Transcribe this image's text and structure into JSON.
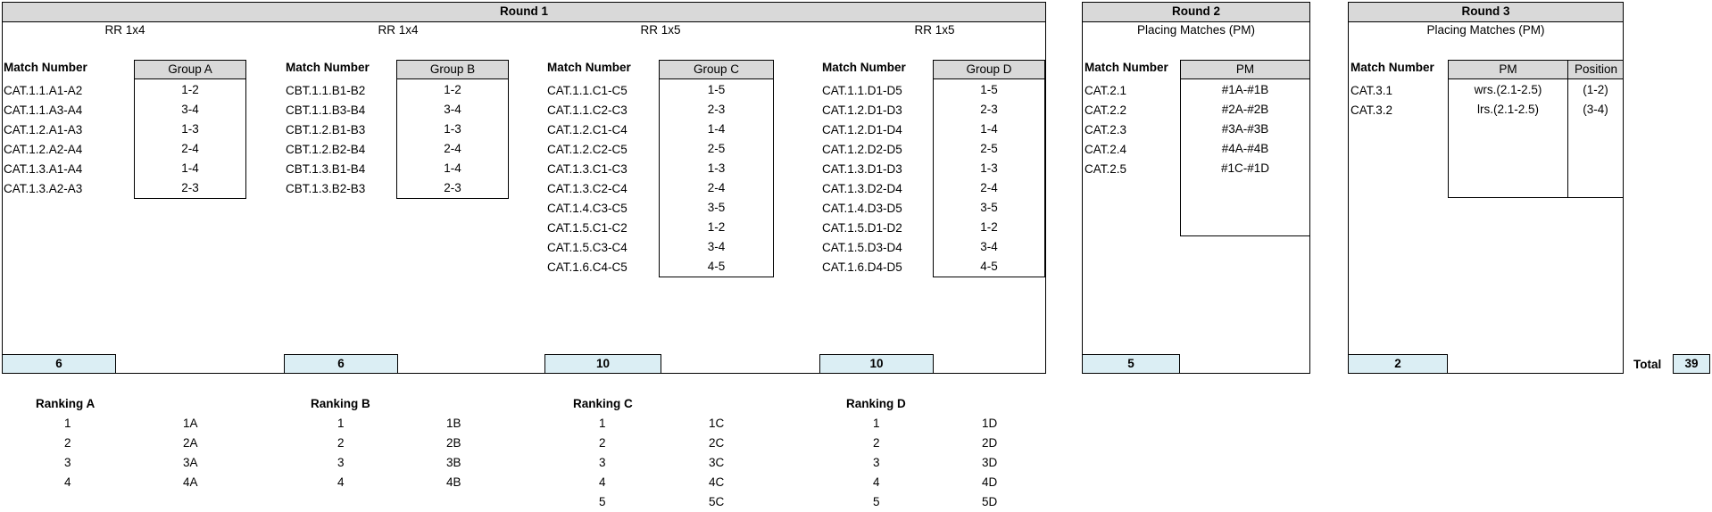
{
  "round1": {
    "title": "Round 1",
    "groups": [
      {
        "sub": "RR 1x4",
        "match_header": "Match Number",
        "col_header": "Group A",
        "count": "6",
        "matches": [
          "CAT.1.1.A1-A2",
          "CAT.1.1.A3-A4",
          "CAT.1.2.A1-A3",
          "CAT.1.2.A2-A4",
          "CAT.1.3.A1-A4",
          "CAT.1.3.A2-A3"
        ],
        "pairs": [
          "1-2",
          "3-4",
          "1-3",
          "2-4",
          "1-4",
          "2-3"
        ]
      },
      {
        "sub": "RR 1x4",
        "match_header": "Match Number",
        "col_header": "Group B",
        "count": "6",
        "matches": [
          "CBT.1.1.B1-B2",
          "CBT.1.1.B3-B4",
          "CBT.1.2.B1-B3",
          "CBT.1.2.B2-B4",
          "CBT.1.3.B1-B4",
          "CBT.1.3.B2-B3"
        ],
        "pairs": [
          "1-2",
          "3-4",
          "1-3",
          "2-4",
          "1-4",
          "2-3"
        ]
      },
      {
        "sub": "RR 1x5",
        "match_header": "Match Number",
        "col_header": "Group C",
        "count": "10",
        "matches": [
          "CAT.1.1.C1-C5",
          "CAT.1.1.C2-C3",
          "CAT.1.2.C1-C4",
          "CAT.1.2.C2-C5",
          "CAT.1.3.C1-C3",
          "CAT.1.3.C2-C4",
          "CAT.1.4.C3-C5",
          "CAT.1.5.C1-C2",
          "CAT.1.5.C3-C4",
          "CAT.1.6.C4-C5"
        ],
        "pairs": [
          "1-5",
          "2-3",
          "1-4",
          "2-5",
          "1-3",
          "2-4",
          "3-5",
          "1-2",
          "3-4",
          "4-5"
        ]
      },
      {
        "sub": "RR 1x5",
        "match_header": "Match Number",
        "col_header": "Group D",
        "count": "10",
        "matches": [
          "CAT.1.1.D1-D5",
          "CAT.1.2.D1-D3",
          "CAT.1.2.D1-D4",
          "CAT.1.2.D2-D5",
          "CAT.1.3.D1-D3",
          "CAT.1.3.D2-D4",
          "CAT.1.4.D3-D5",
          "CAT.1.5.D1-D2",
          "CAT.1.5.D3-D4",
          "CAT.1.6.D4-D5"
        ],
        "pairs": [
          "1-5",
          "2-3",
          "1-4",
          "2-5",
          "1-3",
          "2-4",
          "3-5",
          "1-2",
          "3-4",
          "4-5"
        ]
      }
    ]
  },
  "round2": {
    "title": "Round 2",
    "sub": "Placing Matches (PM)",
    "match_header": "Match Number",
    "col_header": "PM",
    "count": "5",
    "matches": [
      "CAT.2.1",
      "CAT.2.2",
      "CAT.2.3",
      "CAT.2.4",
      "CAT.2.5"
    ],
    "pm": [
      "#1A-#1B",
      "#2A-#2B",
      "#3A-#3B",
      "#4A-#4B",
      "#1C-#1D"
    ]
  },
  "round3": {
    "title": "Round 3",
    "sub": "Placing Matches (PM)",
    "match_header": "Match Number",
    "col_header": "PM",
    "col_header2": "Position",
    "count": "2",
    "matches": [
      "CAT.3.1",
      "CAT.3.2"
    ],
    "pm": [
      "wrs.(2.1-2.5)",
      "lrs.(2.1-2.5)"
    ],
    "positions": [
      "(1-2)",
      "(3-4)"
    ]
  },
  "total": {
    "label": "Total",
    "value": "39"
  },
  "rankings": [
    {
      "title": "Ranking A",
      "nums": [
        "1",
        "2",
        "3",
        "4"
      ],
      "labels": [
        "1A",
        "2A",
        "3A",
        "4A"
      ]
    },
    {
      "title": "Ranking B",
      "nums": [
        "1",
        "2",
        "3",
        "4"
      ],
      "labels": [
        "1B",
        "2B",
        "3B",
        "4B"
      ]
    },
    {
      "title": "Ranking C",
      "nums": [
        "1",
        "2",
        "3",
        "4",
        "5"
      ],
      "labels": [
        "1C",
        "2C",
        "3C",
        "4C",
        "5C"
      ]
    },
    {
      "title": "Ranking D",
      "nums": [
        "1",
        "2",
        "3",
        "4",
        "5"
      ],
      "labels": [
        "1D",
        "2D",
        "3D",
        "4D",
        "5D"
      ]
    }
  ]
}
